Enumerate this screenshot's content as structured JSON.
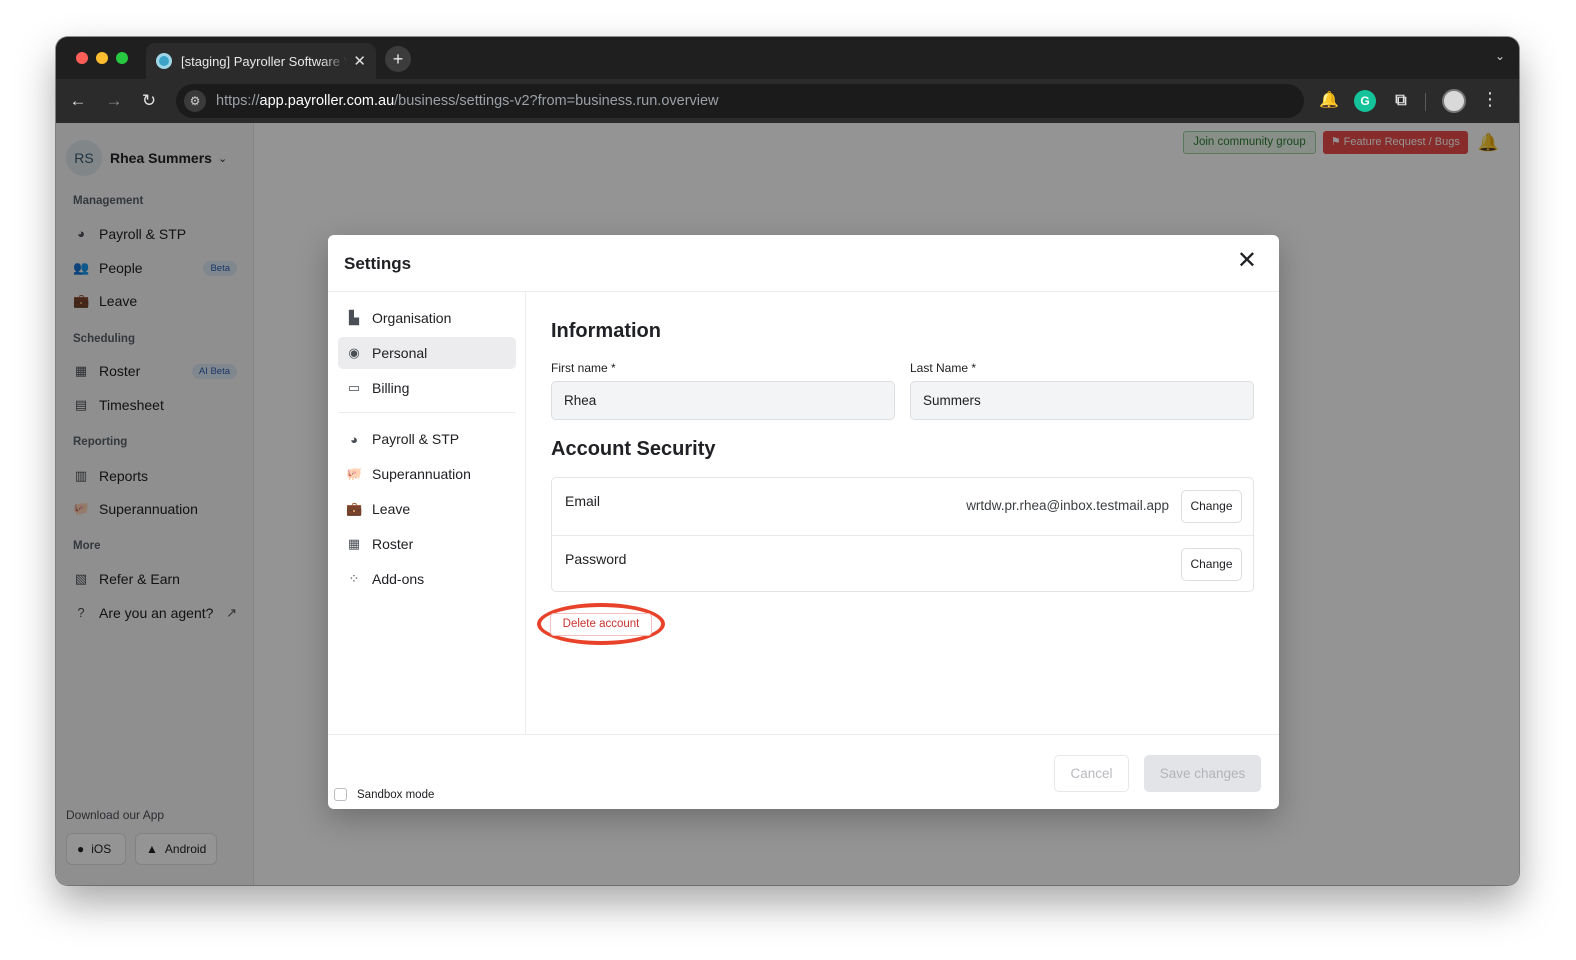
{
  "browser": {
    "tab_title": "[staging] Payroller Software V",
    "tab_close": "✕",
    "new_tab": "+",
    "url_scheme": "https://",
    "url_host": "app.payroller.com.au",
    "url_path": "/business/settings-v2?from=business.run.overview",
    "ext_grammarly": "G"
  },
  "sidebar": {
    "initials": "RS",
    "user_name": "Rhea Summers",
    "sections": {
      "management": "Management",
      "scheduling": "Scheduling",
      "reporting": "Reporting",
      "more": "More"
    },
    "items": {
      "payroll": "Payroll & STP",
      "people": "People",
      "people_badge": "Beta",
      "leave": "Leave",
      "roster": "Roster",
      "roster_badge": "AI Beta",
      "timesheet": "Timesheet",
      "reports": "Reports",
      "superannuation": "Superannuation",
      "refer": "Refer & Earn",
      "agent": "Are you an agent?"
    },
    "download_title": "Download our App",
    "ios": "iOS",
    "android": "Android"
  },
  "topbar": {
    "join_community": "Join community group",
    "feature_request": "Feature Request / Bugs"
  },
  "modal": {
    "title": "Settings",
    "nav": {
      "organisation": "Organisation",
      "personal": "Personal",
      "billing": "Billing",
      "payroll": "Payroll & STP",
      "superannuation": "Superannuation",
      "leave": "Leave",
      "roster": "Roster",
      "addons": "Add-ons"
    },
    "information_heading": "Information",
    "first_name_label": "First name *",
    "first_name_value": "Rhea",
    "last_name_label": "Last Name *",
    "last_name_value": "Summers",
    "security_heading": "Account Security",
    "email_label": "Email",
    "email_value": "wrtdw.pr.rhea@inbox.testmail.app",
    "password_label": "Password",
    "change_label": "Change",
    "delete_account": "Delete account",
    "sandbox_mode": "Sandbox mode",
    "cancel": "Cancel",
    "save_changes": "Save changes"
  },
  "colors": {
    "annotation_highlight": "#e8432a",
    "delete_text": "#c7342f",
    "feature_button": "#e84a4a",
    "join_button": "#2f7d32"
  }
}
